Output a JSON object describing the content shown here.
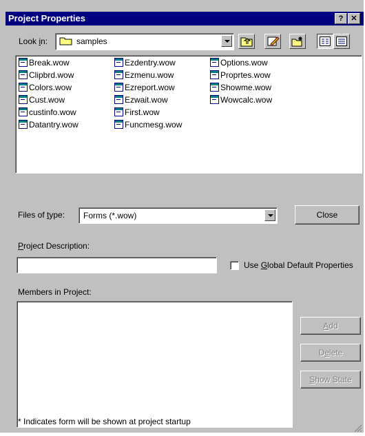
{
  "window": {
    "title": "Project Properties",
    "help_glyph": "?",
    "close_glyph": "✕"
  },
  "lookin": {
    "label_pre": "Look ",
    "label_u": "i",
    "label_post": "n:",
    "value": "samples"
  },
  "files": [
    "Break.wow",
    "Clipbrd.wow",
    "Colors.wow",
    "Cust.wow",
    "custinfo.wow",
    "Datantry.wow",
    "Ezdentry.wow",
    "Ezmenu.wow",
    "Ezreport.wow",
    "Ezwait.wow",
    "First.wow",
    "Funcmesg.wow",
    "Options.wow",
    "Proprtes.wow",
    "Showme.wow",
    "Wowcalc.wow"
  ],
  "filetype": {
    "label_pre": "Files of ",
    "label_u": "t",
    "label_post": "ype:",
    "value": "Forms (*.wow)"
  },
  "buttons": {
    "close": "Close"
  },
  "description": {
    "label_u": "P",
    "label_post": "roject Description:",
    "value": ""
  },
  "global": {
    "label_pre": "Use ",
    "label_u": "G",
    "label_post": "lobal Default Properties",
    "checked": false
  },
  "members": {
    "label": "Members in Project:"
  },
  "side_buttons": {
    "add_u": "A",
    "add_post": "dd",
    "delete_pre": "D",
    "delete_u": "e",
    "delete_post": "lete",
    "show_u": "S",
    "show_post": "how State"
  },
  "footnote": "* Indicates form will be shown at project startup"
}
